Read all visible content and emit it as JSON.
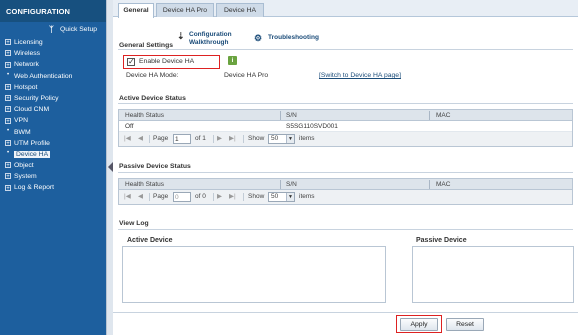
{
  "sidebar": {
    "title": "CONFIGURATION",
    "quick_setup": "Quick Setup",
    "items": [
      {
        "label": "Licensing",
        "marker": "+"
      },
      {
        "label": "Wireless",
        "marker": "+"
      },
      {
        "label": "Network",
        "marker": "+"
      },
      {
        "label": "Web Authentication",
        "marker": "•"
      },
      {
        "label": "Hotspot",
        "marker": "+"
      },
      {
        "label": "Security Policy",
        "marker": "+"
      },
      {
        "label": "Cloud CNM",
        "marker": "+"
      },
      {
        "label": "VPN",
        "marker": "+"
      },
      {
        "label": "BWM",
        "marker": "•"
      },
      {
        "label": "UTM Profile",
        "marker": "+"
      },
      {
        "label": "Device HA",
        "marker": "•"
      },
      {
        "label": "Object",
        "marker": "+"
      },
      {
        "label": "System",
        "marker": "+"
      },
      {
        "label": "Log & Report",
        "marker": "+"
      }
    ]
  },
  "tabs": [
    "General",
    "Device HA Pro",
    "Device HA"
  ],
  "general_settings": {
    "title": "General Settings",
    "config_walkthrough": "Configuration\nWalkthrough",
    "config_walkthrough_line1": "Configuration",
    "config_walkthrough_line2": "Walkthrough",
    "troubleshooting": "Troubleshooting",
    "enable_label": "Enable Device HA",
    "enable_checked": true,
    "mode_label": "Device HA Mode:",
    "mode_value": "Device HA Pro",
    "switch_link": "[Switch to Device HA page]"
  },
  "active_status": {
    "title": "Active Device Status",
    "headers": [
      "Health Status",
      "S/N",
      "MAC"
    ],
    "rows": [
      [
        "Off",
        "S5SG110SVD001",
        ""
      ]
    ],
    "pager": {
      "page_label": "Page",
      "page_value": "1",
      "of_label": "of 1",
      "show_label": "Show",
      "show_value": "50",
      "items_label": "items"
    }
  },
  "passive_status": {
    "title": "Passive Device Status",
    "headers": [
      "Health Status",
      "S/N",
      "MAC"
    ],
    "pager": {
      "page_label": "Page",
      "page_value": "0",
      "of_label": "of 0",
      "show_label": "Show",
      "show_value": "50",
      "items_label": "items"
    }
  },
  "view_log": {
    "title": "View Log",
    "active_device": "Active Device",
    "passive_device": "Passive Device"
  },
  "buttons": {
    "apply": "Apply",
    "reset": "Reset"
  },
  "colors": {
    "sidebar_bg": "#1d5f9e",
    "highlight": "#dd2222",
    "info_icon": "#6aa33f"
  }
}
